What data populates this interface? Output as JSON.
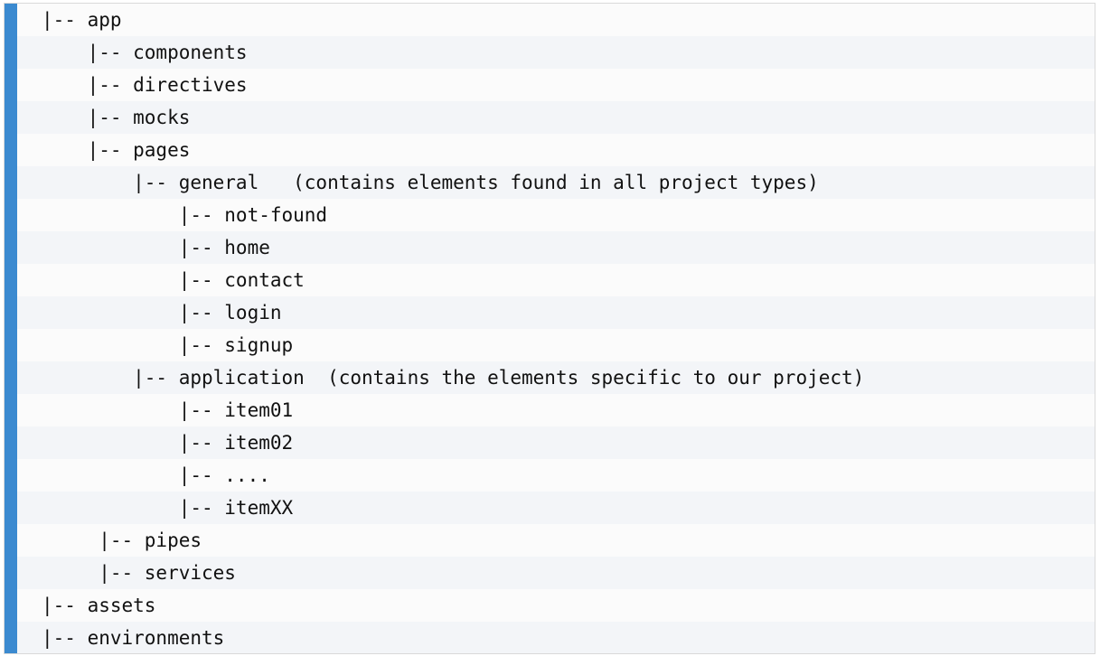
{
  "tree": {
    "lines": [
      "|-- app",
      "    |-- components",
      "    |-- directives",
      "    |-- mocks",
      "    |-- pages",
      "        |-- general   (contains elements found in all project types)",
      "            |-- not-found",
      "            |-- home",
      "            |-- contact",
      "            |-- login",
      "            |-- signup",
      "        |-- application  (contains the elements specific to our project)",
      "            |-- item01",
      "            |-- item02",
      "            |-- ....",
      "            |-- itemXX",
      "     |-- pipes",
      "     |-- services",
      "|-- assets",
      "|-- environments"
    ]
  }
}
